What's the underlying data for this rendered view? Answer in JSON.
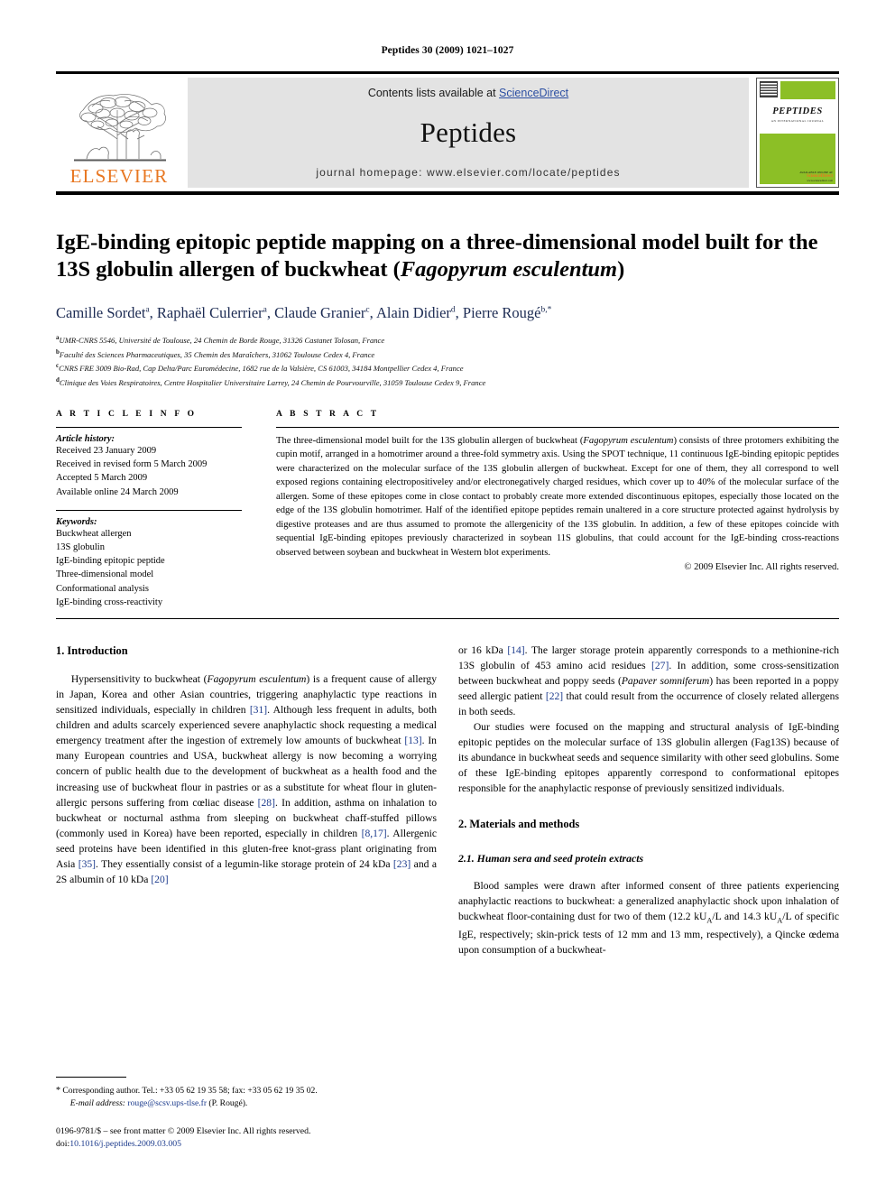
{
  "running_head": "Peptides 30 (2009) 1021–1027",
  "journal_header": {
    "contents_prefix": "Contents lists available at ",
    "sciencedirect": "ScienceDirect",
    "journal_title": "Peptides",
    "homepage": "journal homepage: www.elsevier.com/locate/peptides",
    "publisher_wordmark": "ELSEVIER",
    "publisher_color": "#E87722",
    "link_color": "#2b4ea2",
    "cover": {
      "title": "PEPTIDES",
      "subtitle": "AN INTERNATIONAL JOURNAL",
      "footer_line1": "AVAILABLE ONLINE AT",
      "footer_line2": "ScienceDirect",
      "footer_line3": "www.sciencedirect.com",
      "accent_color": "#8cbf26"
    }
  },
  "article": {
    "title_line1": "IgE-binding epitopic peptide mapping on a three-dimensional model built for the",
    "title_line2_pre": "13S globulin allergen of buckwheat (",
    "title_species": "Fagopyrum esculentum",
    "title_line2_post": ")",
    "authors": [
      {
        "name": "Camille Sordet",
        "sup": "a",
        "sep": ", "
      },
      {
        "name": "Raphaël Culerrier",
        "sup": "a",
        "sep": ", "
      },
      {
        "name": "Claude Granier",
        "sup": "c",
        "sep": ", "
      },
      {
        "name": "Alain Didier",
        "sup": "d",
        "sep": ", "
      },
      {
        "name": "Pierre Rougé",
        "sup": "b,*",
        "sep": ""
      }
    ],
    "affiliations": [
      {
        "sup": "a",
        "text": "UMR-CNRS 5546, Université de Toulouse, 24 Chemin de Borde Rouge, 31326 Castanet Tolosan, France"
      },
      {
        "sup": "b",
        "text": "Faculté des Sciences Pharmaceutiques, 35 Chemin des Maraîchers, 31062 Toulouse Cedex 4, France"
      },
      {
        "sup": "c",
        "text": "CNRS FRE 3009 Bio-Rad, Cap Delta/Parc Euromédecine, 1682 rue de la Valsière, CS 61003, 34184 Montpellier Cedex 4, France"
      },
      {
        "sup": "d",
        "text": "Clinique des Voies Respiratoires, Centre Hospitalier Universitaire Larrey, 24 Chemin de Pourvourville, 31059 Toulouse Cedex 9, France"
      }
    ]
  },
  "article_info": {
    "heading": "A R T I C L E  I N F O",
    "history_label": "Article history:",
    "history": [
      "Received 23 January 2009",
      "Received in revised form 5 March 2009",
      "Accepted 5 March 2009",
      "Available online 24 March 2009"
    ],
    "keywords_label": "Keywords:",
    "keywords": [
      "Buckwheat allergen",
      "13S globulin",
      "IgE-binding epitopic peptide",
      "Three-dimensional model",
      "Conformational analysis",
      "IgE-binding cross-reactivity"
    ]
  },
  "abstract": {
    "heading": "A B S T R A C T",
    "part1": "The three-dimensional model built for the 13S globulin allergen of buckwheat (",
    "species": "Fagopyrum esculentum",
    "part2": ") consists of three protomers exhibiting the cupin motif, arranged in a homotrimer around a three-fold symmetry axis. Using the SPOT technique, 11 continuous IgE-binding epitopic peptides were characterized on the molecular surface of the 13S globulin allergen of buckwheat. Except for one of them, they all correspond to well exposed regions containing electropositiveley and/or electronegatively charged residues, which cover up to 40% of the molecular surface of the allergen. Some of these epitopes come in close contact to probably create more extended discontinuous epitopes, especially those located on the edge of the 13S globulin homotrimer. Half of the identified epitope peptides remain unaltered in a core structure protected against hydrolysis by digestive proteases and are thus assumed to promote the allergenicity of the 13S globulin. In addition, a few of these epitopes coincide with sequential IgE-binding epitopes previously characterized in soybean 11S globulins, that could account for the IgE-binding cross-reactions observed between soybean and buckwheat in Western blot experiments.",
    "copyright": "© 2009 Elsevier Inc. All rights reserved."
  },
  "sections": {
    "intro_heading": "1. Introduction",
    "intro_p1_a": "Hypersensitivity to buckwheat (",
    "intro_p1_species": "Fagopyrum esculentum",
    "intro_p1_b": ") is a frequent cause of allergy in Japan, Korea and other Asian countries, triggering anaphylactic type reactions in sensitized individuals, especially in children ",
    "intro_ref_31": "[31]",
    "intro_p1_c": ". Although less frequent in adults, both children and adults scarcely experienced severe anaphylactic shock requesting a medical emergency treatment after the ingestion of extremely low amounts of buckwheat ",
    "intro_ref_13": "[13]",
    "intro_p1_d": ". In many European countries and USA, buckwheat allergy is now becoming a worrying concern of public health due to the development of buckwheat as a health food and the increasing use of buckwheat flour in pastries or as a substitute for wheat flour in gluten-allergic persons suffering from cœliac disease ",
    "intro_ref_28": "[28]",
    "intro_p1_e": ". In addition, asthma on inhalation to buckwheat or nocturnal asthma from sleeping on buckwheat chaff-stuffed pillows (commonly used in Korea) have been reported, especially in children ",
    "intro_ref_8_17": "[8,17]",
    "intro_p1_f": ". Allergenic seed proteins have been identified in this gluten-free knot-grass plant originating from Asia ",
    "intro_ref_35": "[35]",
    "intro_p1_g": ". They essentially consist of a legumin-like storage protein of 24 kDa ",
    "intro_ref_23": "[23]",
    "intro_p1_h": " and a 2S albumin of 10 kDa ",
    "intro_ref_20": "[20]",
    "right_p1_a": "or 16 kDa ",
    "right_ref_14": "[14]",
    "right_p1_b": ". The larger storage protein apparently corresponds to a methionine-rich 13S globulin of 453 amino acid residues ",
    "right_ref_27": "[27]",
    "right_p1_c": ". In addition, some cross-sensitization between buckwheat and poppy seeds (",
    "right_species": "Papaver somniferum",
    "right_p1_d": ") has been reported in a poppy seed allergic patient ",
    "right_ref_22": "[22]",
    "right_p1_e": " that could result from the occurrence of closely related allergens in both seeds.",
    "right_p2": "Our studies were focused on the mapping and structural analysis of IgE-binding epitopic peptides on the molecular surface of 13S globulin allergen (Fag13S) because of its abundance in buckwheat seeds and sequence similarity with other seed globulins. Some of these IgE-binding epitopes apparently correspond to conformational epitopes responsible for the anaphylactic response of previously sensitized individuals.",
    "methods_heading": "2. Materials and methods",
    "sub_heading": "2.1. Human sera and seed protein extracts",
    "methods_p1_a": "Blood samples were drawn after informed consent of three patients experiencing anaphylactic reactions to buckwheat: a generalized anaphylactic shock upon inhalation of buckwheat floor-containing dust for two of them (12.2 kU",
    "methods_sub_a1": "A",
    "methods_p1_b": "/L and 14.3 kU",
    "methods_sub_a2": "A",
    "methods_p1_c": "/L of specific IgE, respectively; skin-prick tests of 12 mm and 13 mm, respectively), a Qincke œdema upon consumption of a buckwheat-"
  },
  "footnote": {
    "star": "*",
    "corresponding": "Corresponding author. Tel.: +33 05 62 19 35 58; fax: +33 05 62 19 35 02.",
    "email_label": "E-mail address:",
    "email": "rouge@scsv.ups-tlse.fr",
    "email_owner": "(P. Rougé).",
    "imprint_line1": "0196-9781/$ – see front matter © 2009 Elsevier Inc. All rights reserved.",
    "doi_label": "doi:",
    "doi": "10.1016/j.peptides.2009.03.005"
  }
}
